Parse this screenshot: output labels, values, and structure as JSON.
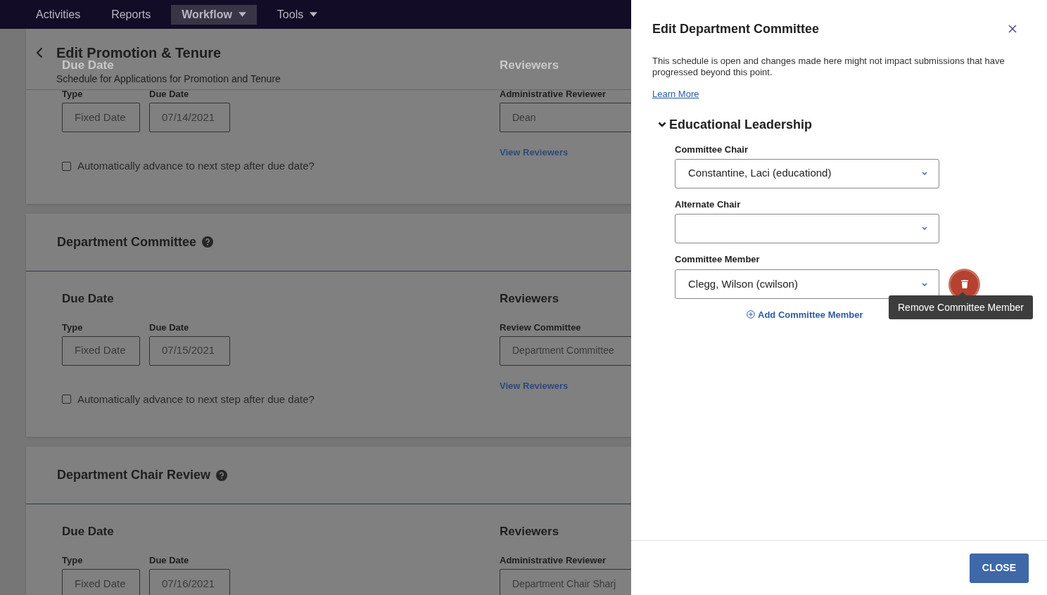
{
  "nav": {
    "items": [
      {
        "label": "Activities",
        "selected": false,
        "has_menu": false
      },
      {
        "label": "Reports",
        "selected": false,
        "has_menu": false
      },
      {
        "label": "Workflow",
        "selected": true,
        "has_menu": true
      },
      {
        "label": "Tools",
        "selected": false,
        "has_menu": true
      }
    ]
  },
  "page": {
    "title": "Edit Promotion & Tenure",
    "subtitle": "Schedule for Applications for Promotion and Tenure"
  },
  "sections": [
    {
      "headings_obscured": true,
      "due_heading": "Due Date",
      "type_label": "Type",
      "type_value": "Fixed Date",
      "date_label": "Due Date",
      "date_value": "07/14/2021",
      "auto_advance": {
        "label": "Automatically advance to next step after due date?",
        "checked": false
      },
      "reviewers_heading": "Reviewers",
      "reviewer_label": "Administrative Reviewer",
      "reviewer_value": "Dean",
      "link": "View Reviewers"
    },
    {
      "title": "Department Committee",
      "headings_obscured": false,
      "due_heading": "Due Date",
      "type_label": "Type",
      "type_value": "Fixed Date",
      "date_label": "Due Date",
      "date_value": "07/15/2021",
      "auto_advance": {
        "label": "Automatically advance to next step after due date?",
        "checked": false
      },
      "reviewers_heading": "Reviewers",
      "reviewer_label": "Review Committee",
      "reviewer_value": "Department Committee",
      "link": "View Reviewers"
    },
    {
      "title": "Department Chair Review",
      "headings_obscured": false,
      "due_heading": "Due Date",
      "type_label": "Type",
      "type_value": "Fixed Date",
      "date_label": "Due Date",
      "date_value": "07/16/2021",
      "reviewers_heading": "Reviewers",
      "reviewer_label": "Administrative Reviewer",
      "reviewer_value": "Department Chair Sharj"
    }
  ],
  "panel": {
    "title": "Edit Department Committee",
    "description": "This schedule is open and changes made here might not impact submissions that have progressed beyond this point.",
    "learn_more": "Learn More",
    "group": {
      "title": "Educational Leadership",
      "expanded": true,
      "fields": [
        {
          "label": "Committee Chair",
          "value": "Constantine, Laci (educationd)",
          "removable": false
        },
        {
          "label": "Alternate Chair",
          "removable": false
        },
        {
          "label": "Committee Member",
          "value": "Clegg, Wilson (cwilson)",
          "removable": true
        }
      ]
    },
    "add_link": "Add Committee Member",
    "tooltip": "Remove Committee Member",
    "close_button": "CLOSE"
  }
}
